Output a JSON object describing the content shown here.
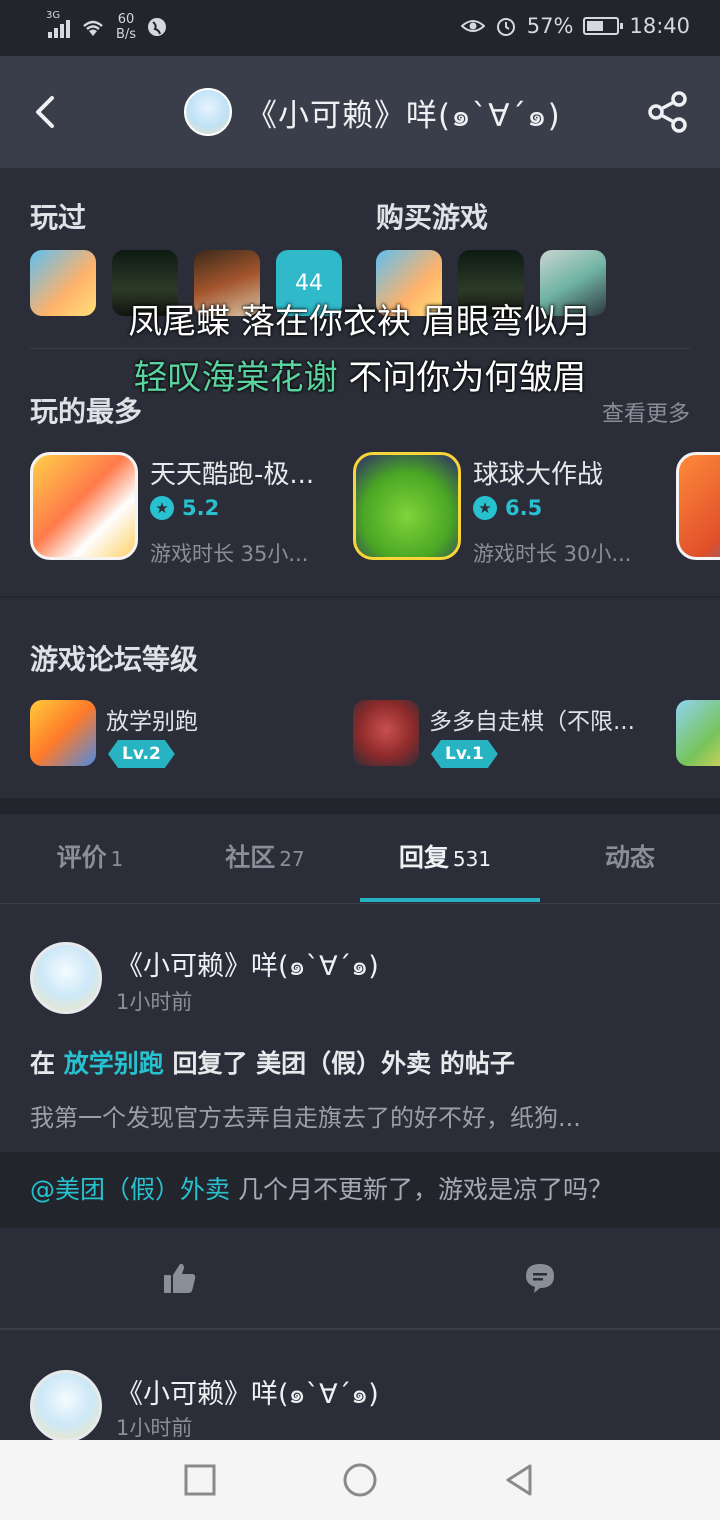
{
  "status": {
    "network_type": "3G",
    "net_speed_value": "60",
    "net_speed_unit": "B/s",
    "battery": "57%",
    "battery_level": 0.57,
    "time": "18:40"
  },
  "header": {
    "title": "《小可赖》咩(๑`∀´๑)",
    "icons": [
      "back-icon",
      "share-icon"
    ]
  },
  "played": {
    "played_label": "玩过",
    "bought_label": "购买游戏",
    "played_more_count": "44"
  },
  "lyrics": {
    "line1": "凤尾蝶 落在你衣袂 眉眼弯似月",
    "line2_highlight": "轻叹海棠花谢 ",
    "line2_rest": "不问你为何皱眉"
  },
  "most_played": {
    "label": "玩的最多",
    "more": "查看更多",
    "games": [
      {
        "name": "天天酷跑-极...",
        "rating": "5.2",
        "playtime": "游戏时长 35小..."
      },
      {
        "name": "球球大作战",
        "rating": "6.5",
        "playtime": "游戏时长 30小..."
      }
    ]
  },
  "forum_level": {
    "label": "游戏论坛等级",
    "items": [
      {
        "name": "放学别跑",
        "level": "Lv.2"
      },
      {
        "name": "多多自走棋（不限...",
        "level": "Lv.1"
      }
    ]
  },
  "tabs": [
    {
      "label": "评价",
      "count": "1"
    },
    {
      "label": "社区",
      "count": "27"
    },
    {
      "label": "回复",
      "count": "531"
    },
    {
      "label": "动态",
      "count": ""
    }
  ],
  "active_tab": "回复",
  "feed": [
    {
      "user": "《小可赖》咩(๑`∀´๑)",
      "time": "1小时前",
      "title_prefix": "在 ",
      "title_link": "放学别跑",
      "title_mid": " 回复了 美团（假）外卖 的帖子",
      "body": "我第一个发现官方去弄自走旗去了的好不好，纸狗...",
      "quote_mention": "@美团（假）外卖",
      "quote_text": " 几个月不更新了，游戏是凉了吗？"
    },
    {
      "user": "《小可赖》咩(๑`∀´๑)",
      "time": "1小时前"
    }
  ],
  "navbar": {
    "icons": [
      "recent-apps-icon",
      "home-icon",
      "back-nav-icon"
    ]
  }
}
